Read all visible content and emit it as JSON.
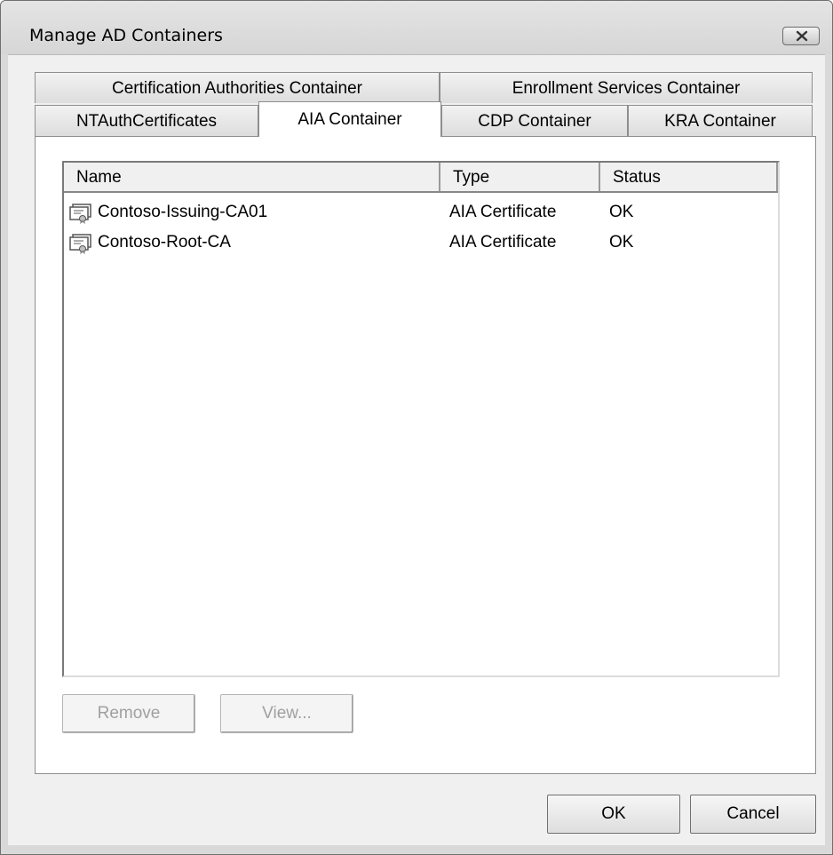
{
  "window": {
    "title": "Manage AD Containers"
  },
  "tabs": {
    "row_top": [
      {
        "label": "Certification Authorities Container"
      },
      {
        "label": "Enrollment Services Container"
      }
    ],
    "row_bottom": [
      {
        "label": "NTAuthCertificates"
      },
      {
        "label": "AIA Container",
        "selected": true
      },
      {
        "label": "CDP Container"
      },
      {
        "label": "KRA Container"
      }
    ]
  },
  "list": {
    "columns": [
      {
        "label": "Name"
      },
      {
        "label": "Type"
      },
      {
        "label": "Status"
      }
    ],
    "rows": [
      {
        "icon": "certificate-icon",
        "name": "Contoso-Issuing-CA01",
        "type": "AIA Certificate",
        "status": "OK"
      },
      {
        "icon": "certificate-icon",
        "name": "Contoso-Root-CA",
        "type": "AIA Certificate",
        "status": "OK"
      }
    ]
  },
  "panel_buttons": {
    "remove_label": "Remove",
    "view_label": "View..."
  },
  "dialog_buttons": {
    "ok_label": "OK",
    "cancel_label": "Cancel"
  },
  "icons": {
    "close": "close-icon"
  },
  "colors": {
    "window_bg": "#d9d9d9",
    "panel_bg": "#ffffff",
    "disabled_text": "#a0a0a0"
  }
}
